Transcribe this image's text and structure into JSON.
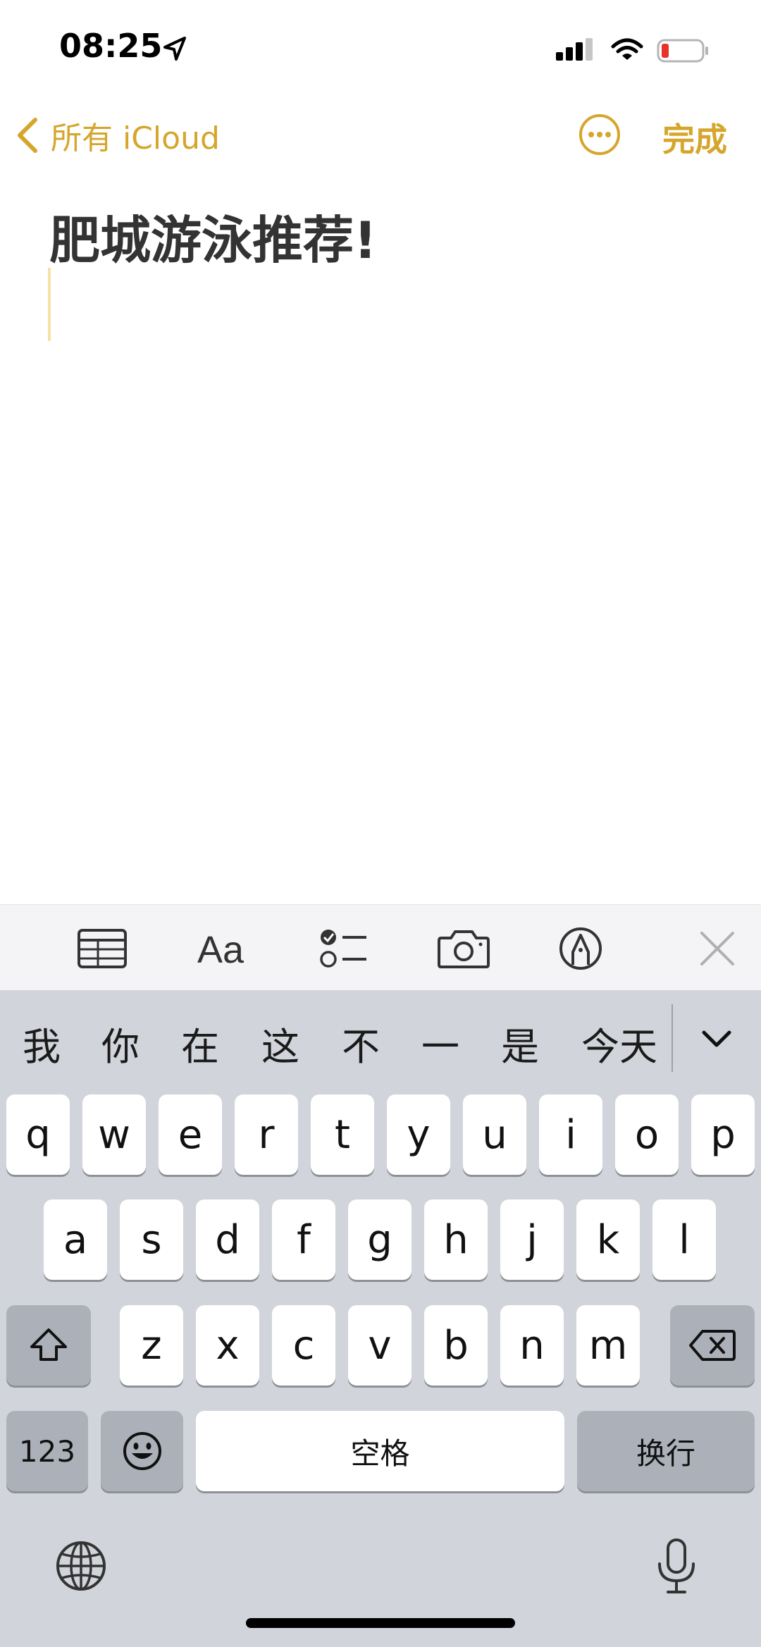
{
  "status": {
    "time": "08:25"
  },
  "nav": {
    "back_label": "所有 iCloud",
    "done_label": "完成"
  },
  "note": {
    "title": "肥城游泳推荐!"
  },
  "keyboard": {
    "candidates": [
      "我",
      "你",
      "在",
      "这",
      "不",
      "一",
      "是",
      "今天"
    ],
    "row1": [
      "q",
      "w",
      "e",
      "r",
      "t",
      "y",
      "u",
      "i",
      "o",
      "p"
    ],
    "row2": [
      "a",
      "s",
      "d",
      "f",
      "g",
      "h",
      "j",
      "k",
      "l"
    ],
    "row3": [
      "z",
      "x",
      "c",
      "v",
      "b",
      "n",
      "m"
    ],
    "numbers_label": "123",
    "space_label": "空格",
    "return_label": "换行"
  },
  "colors": {
    "accent": "#d6a62c",
    "keyboard_bg": "#d1d4da",
    "toolbar_bg": "#f4f4f6"
  }
}
